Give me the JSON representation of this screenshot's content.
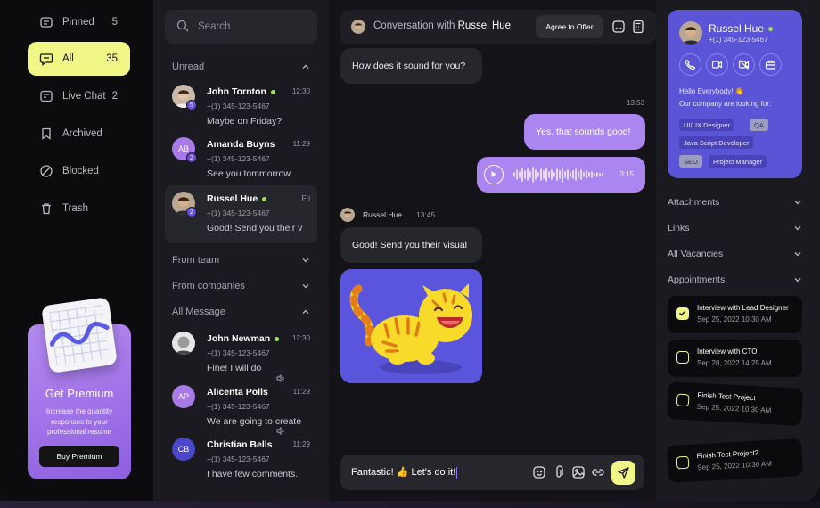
{
  "nav": {
    "items": [
      {
        "label": "Pinned",
        "count": "5",
        "icon": "pin-icon"
      },
      {
        "label": "All",
        "count": "35",
        "icon": "chat-icon"
      },
      {
        "label": "Live Chat",
        "count": "2",
        "icon": "live-chat-icon"
      },
      {
        "label": "Archived",
        "count": "",
        "icon": "bookmark-icon"
      },
      {
        "label": "Blocked",
        "count": "",
        "icon": "blocked-icon"
      },
      {
        "label": "Trash",
        "count": "",
        "icon": "trash-icon"
      }
    ],
    "premium": {
      "title": "Get Premium",
      "text": "Increase the quantity responses to your professional resume",
      "button": "Buy Premium"
    }
  },
  "list": {
    "search_placeholder": "Search",
    "sections": {
      "unread": "Unread",
      "team": "From team",
      "companies": "From companies",
      "all": "All Message"
    },
    "unread": [
      {
        "name": "John Tornton",
        "phone": "+(1) 345-123-5467",
        "message": "Maybe on Friday?",
        "time": "12:30",
        "badge": "5",
        "online": true
      },
      {
        "name": "Amanda Buyns",
        "phone": "+(1) 345-123-5467",
        "message": "See you tommorrow",
        "time": "11:29",
        "badge": "2",
        "initials": "AB",
        "online": false
      },
      {
        "name": "Russel Hue",
        "phone": "+(1) 345-123-5467",
        "message": "Good! Send you their visual",
        "time": "Fri",
        "badge": "2",
        "online": true
      }
    ],
    "all": [
      {
        "name": "John Newman",
        "phone": "+(1) 345-123-5467",
        "message": "Fine! I will do",
        "time": "12:30",
        "online": true
      },
      {
        "name": "Alicenta Polls",
        "phone": "+(1) 345-123-5467",
        "message": "We are going to create",
        "time": "11:29",
        "initials": "AP",
        "online": false
      },
      {
        "name": "Christian Bells",
        "phone": "+(1) 345-123-5467",
        "message": "I have few comments..",
        "time": "11:29",
        "initials": "CB",
        "online": false
      }
    ]
  },
  "conversation": {
    "title_prefix": "Conversation with",
    "title_name": "Russel Hue",
    "agree_button": "Agree to Offer",
    "messages": {
      "m1": "How does it sound for you?",
      "time1": "13:53",
      "m2": "Yes, that sounds good!",
      "voice_duration": "3:15",
      "sender": "Russel Hue",
      "sender_time": "13:45",
      "m3": "Good! Send you their visual"
    },
    "composer_text": "Fantastic! 👍 Let's do it!"
  },
  "profile": {
    "name": "Russel Hue",
    "phone": "+(1) 345-123-5467",
    "hello": "Hello Everybody! 👋",
    "looking": "Our company are looking for:",
    "tags": [
      "UI/UX Designer",
      "QA",
      "Java Script Developer",
      "SEO",
      "Project Manager"
    ],
    "accordions": [
      "Attachments",
      "Links",
      "All Vacancies",
      "Appointments"
    ],
    "appointments": [
      {
        "title": "Interview with Lead Designer",
        "date": "Sep 25, 2022 10:30 AM",
        "done": true
      },
      {
        "title": "Interview with CTO",
        "date": "Sep 28, 2022 14:25 AM",
        "done": false
      },
      {
        "title": "Finish Test Project",
        "date": "Sep 25, 2022 10:30 AM",
        "done": false
      },
      {
        "title": "Finish Test Project2",
        "date": "Sep 25, 2022 10:30 AM",
        "done": false
      }
    ]
  },
  "colors": {
    "accent_yellow": "#f1f787",
    "accent_purple": "#ab86f0",
    "profile_card": "#5b54d6",
    "online": "#9be15d"
  }
}
